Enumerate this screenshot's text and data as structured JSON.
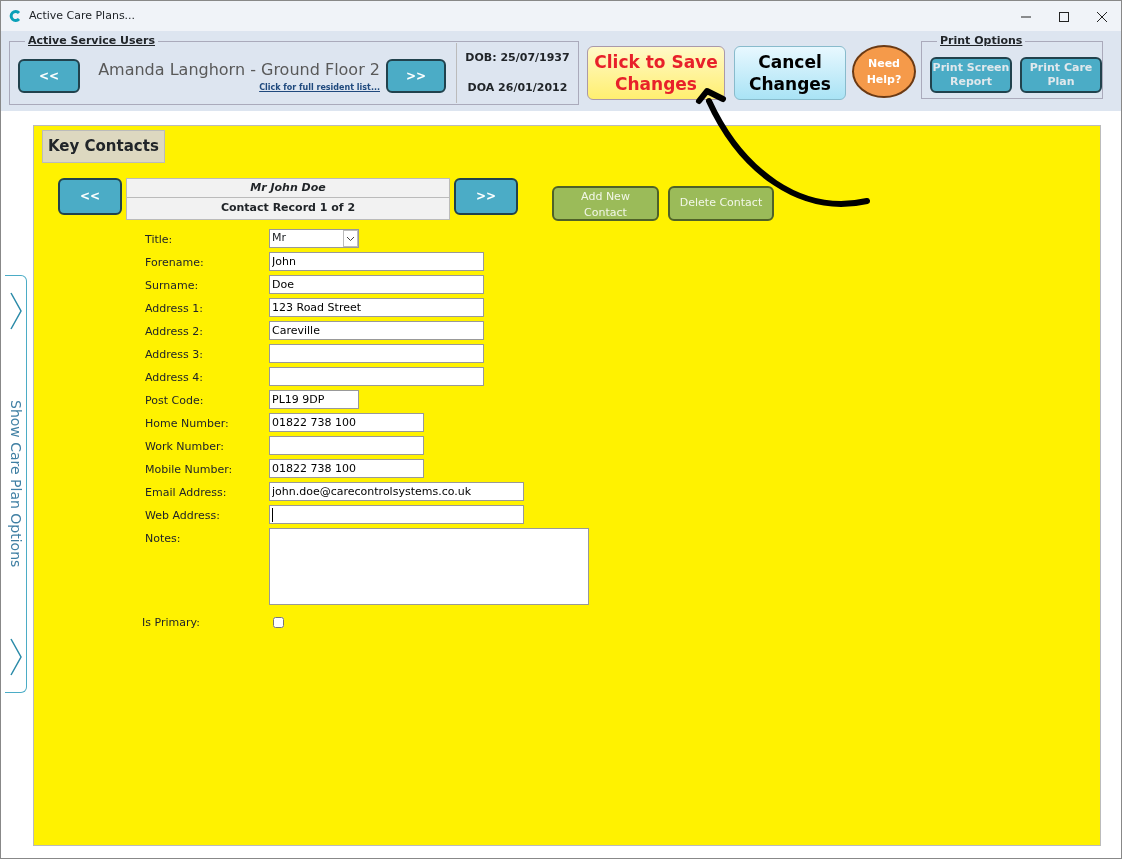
{
  "window": {
    "title": "Active Care Plans..."
  },
  "service_users": {
    "heading": "Active Service Users",
    "prev": "<<",
    "next": ">>",
    "resident": "Amanda Langhorn - Ground Floor 2",
    "list_link": "Click for full resident list...",
    "dob": "DOB: 25/07/1937",
    "doa": "DOA 26/01/2012"
  },
  "actions": {
    "save": "Click to Save Changes",
    "cancel": "Cancel Changes",
    "help": "Need Help?"
  },
  "print_options": {
    "heading": "Print Options",
    "buttons": [
      "Print Screen Report",
      "Print Care Plan"
    ]
  },
  "side_tab": {
    "label": "Show Care Plan Options"
  },
  "key_contacts": {
    "heading": "Key Contacts",
    "prev": "<<",
    "next": ">>",
    "contact_name": "Mr John Doe",
    "record": "Contact Record 1 of 2",
    "add": "Add New Contact",
    "delete": "Delete Contact",
    "fields": [
      {
        "kind": "select",
        "label": "Title:",
        "value": "Mr"
      },
      {
        "kind": "text",
        "label": "Forename:",
        "value": "John"
      },
      {
        "kind": "text",
        "label": "Surname:",
        "value": "Doe"
      },
      {
        "kind": "text",
        "label": "Address 1:",
        "value": "123 Road Street"
      },
      {
        "kind": "text",
        "label": "Address 2:",
        "value": "Careville"
      },
      {
        "kind": "text",
        "label": "Address 3:"
      },
      {
        "kind": "text",
        "label": "Address 4:"
      },
      {
        "kind": "text",
        "label": "Post Code:",
        "value": "PL19 9DP"
      },
      {
        "kind": "text",
        "label": "Home Number:",
        "value": "01822 738 100"
      },
      {
        "kind": "text",
        "label": "Work Number:"
      },
      {
        "kind": "text",
        "label": "Mobile Number:",
        "value": "01822 738 100"
      },
      {
        "kind": "text",
        "label": "Email Address:",
        "value": "john.doe@carecontrolsystems.co.uk"
      },
      {
        "kind": "text",
        "label": "Web Address:",
        "focused": true
      },
      {
        "kind": "textarea",
        "label": "Notes:"
      },
      {
        "kind": "checkbox",
        "label": "Is Primary:",
        "checked": false
      }
    ]
  }
}
